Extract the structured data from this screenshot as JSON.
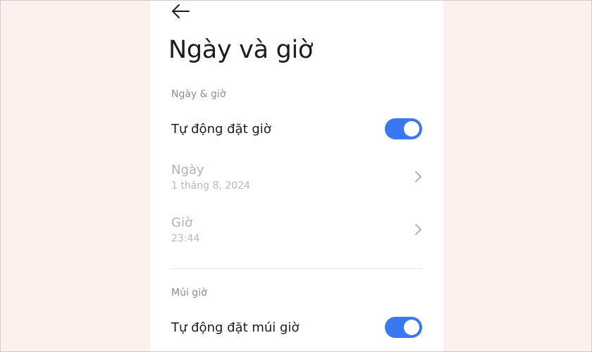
{
  "page": {
    "title": "Ngày và giờ",
    "back_icon": "arrow-left-icon"
  },
  "sections": {
    "date_time": {
      "header": "Ngày & giờ",
      "auto_time": {
        "label": "Tự động đặt giờ",
        "enabled": true
      },
      "date": {
        "label": "Ngày",
        "value": "1 tháng 8, 2024"
      },
      "time": {
        "label": "Giờ",
        "value": "23:44"
      }
    },
    "timezone": {
      "header": "Múi giờ",
      "auto_timezone": {
        "label": "Tự động đặt múi giờ",
        "enabled": true
      }
    }
  },
  "colors": {
    "accent": "#3a78f2",
    "background": "#fdf1ee",
    "text_primary": "#1c1c1c",
    "text_disabled": "#b3b3b3",
    "section_header": "#8e8e8e"
  }
}
